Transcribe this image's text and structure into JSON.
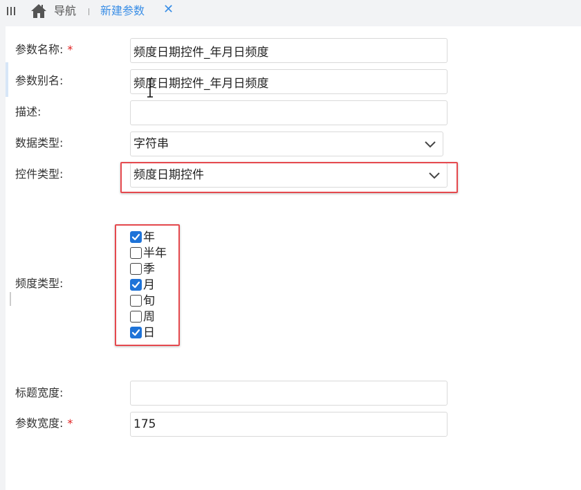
{
  "topbar": {
    "nav_label": "导航",
    "tab_label": "新建参数",
    "tab_close": "✕"
  },
  "form": {
    "param_name": {
      "label": "参数名称:",
      "required": "*",
      "value": "频度日期控件_年月日频度"
    },
    "param_alias": {
      "label": "参数别名:",
      "value": "频度日期控件_年月日频度"
    },
    "description": {
      "label": "描述:",
      "value": ""
    },
    "data_type": {
      "label": "数据类型:",
      "value": "字符串"
    },
    "control_type": {
      "label": "控件类型:",
      "value": "频度日期控件"
    },
    "frequency_type": {
      "label": "频度类型:",
      "options": [
        {
          "label": "年",
          "checked": true
        },
        {
          "label": "半年",
          "checked": false
        },
        {
          "label": "季",
          "checked": false
        },
        {
          "label": "月",
          "checked": true
        },
        {
          "label": "旬",
          "checked": false
        },
        {
          "label": "周",
          "checked": false
        },
        {
          "label": "日",
          "checked": true
        }
      ]
    },
    "title_width": {
      "label": "标题宽度:",
      "value": ""
    },
    "param_width": {
      "label": "参数宽度:",
      "required": "*",
      "value": "175"
    }
  },
  "colors": {
    "accent": "#3a8ee6",
    "checkbox_checked": "#1e73d8",
    "highlight": "#e5484d",
    "required": "#e02020"
  },
  "icons": [
    "menu-toggle-icon",
    "home-icon",
    "chevron-down-icon",
    "check-icon",
    "text-cursor-icon"
  ]
}
